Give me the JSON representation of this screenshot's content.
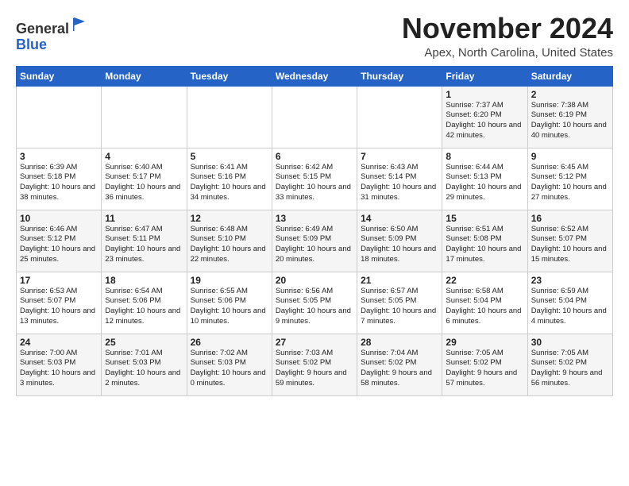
{
  "logo": {
    "general": "General",
    "blue": "Blue"
  },
  "header": {
    "month": "November 2024",
    "location": "Apex, North Carolina, United States"
  },
  "weekdays": [
    "Sunday",
    "Monday",
    "Tuesday",
    "Wednesday",
    "Thursday",
    "Friday",
    "Saturday"
  ],
  "weeks": [
    [
      {
        "day": "",
        "info": ""
      },
      {
        "day": "",
        "info": ""
      },
      {
        "day": "",
        "info": ""
      },
      {
        "day": "",
        "info": ""
      },
      {
        "day": "",
        "info": ""
      },
      {
        "day": "1",
        "info": "Sunrise: 7:37 AM\nSunset: 6:20 PM\nDaylight: 10 hours\nand 42 minutes."
      },
      {
        "day": "2",
        "info": "Sunrise: 7:38 AM\nSunset: 6:19 PM\nDaylight: 10 hours\nand 40 minutes."
      }
    ],
    [
      {
        "day": "3",
        "info": "Sunrise: 6:39 AM\nSunset: 5:18 PM\nDaylight: 10 hours\nand 38 minutes."
      },
      {
        "day": "4",
        "info": "Sunrise: 6:40 AM\nSunset: 5:17 PM\nDaylight: 10 hours\nand 36 minutes."
      },
      {
        "day": "5",
        "info": "Sunrise: 6:41 AM\nSunset: 5:16 PM\nDaylight: 10 hours\nand 34 minutes."
      },
      {
        "day": "6",
        "info": "Sunrise: 6:42 AM\nSunset: 5:15 PM\nDaylight: 10 hours\nand 33 minutes."
      },
      {
        "day": "7",
        "info": "Sunrise: 6:43 AM\nSunset: 5:14 PM\nDaylight: 10 hours\nand 31 minutes."
      },
      {
        "day": "8",
        "info": "Sunrise: 6:44 AM\nSunset: 5:13 PM\nDaylight: 10 hours\nand 29 minutes."
      },
      {
        "day": "9",
        "info": "Sunrise: 6:45 AM\nSunset: 5:12 PM\nDaylight: 10 hours\nand 27 minutes."
      }
    ],
    [
      {
        "day": "10",
        "info": "Sunrise: 6:46 AM\nSunset: 5:12 PM\nDaylight: 10 hours\nand 25 minutes."
      },
      {
        "day": "11",
        "info": "Sunrise: 6:47 AM\nSunset: 5:11 PM\nDaylight: 10 hours\nand 23 minutes."
      },
      {
        "day": "12",
        "info": "Sunrise: 6:48 AM\nSunset: 5:10 PM\nDaylight: 10 hours\nand 22 minutes."
      },
      {
        "day": "13",
        "info": "Sunrise: 6:49 AM\nSunset: 5:09 PM\nDaylight: 10 hours\nand 20 minutes."
      },
      {
        "day": "14",
        "info": "Sunrise: 6:50 AM\nSunset: 5:09 PM\nDaylight: 10 hours\nand 18 minutes."
      },
      {
        "day": "15",
        "info": "Sunrise: 6:51 AM\nSunset: 5:08 PM\nDaylight: 10 hours\nand 17 minutes."
      },
      {
        "day": "16",
        "info": "Sunrise: 6:52 AM\nSunset: 5:07 PM\nDaylight: 10 hours\nand 15 minutes."
      }
    ],
    [
      {
        "day": "17",
        "info": "Sunrise: 6:53 AM\nSunset: 5:07 PM\nDaylight: 10 hours\nand 13 minutes."
      },
      {
        "day": "18",
        "info": "Sunrise: 6:54 AM\nSunset: 5:06 PM\nDaylight: 10 hours\nand 12 minutes."
      },
      {
        "day": "19",
        "info": "Sunrise: 6:55 AM\nSunset: 5:06 PM\nDaylight: 10 hours\nand 10 minutes."
      },
      {
        "day": "20",
        "info": "Sunrise: 6:56 AM\nSunset: 5:05 PM\nDaylight: 10 hours\nand 9 minutes."
      },
      {
        "day": "21",
        "info": "Sunrise: 6:57 AM\nSunset: 5:05 PM\nDaylight: 10 hours\nand 7 minutes."
      },
      {
        "day": "22",
        "info": "Sunrise: 6:58 AM\nSunset: 5:04 PM\nDaylight: 10 hours\nand 6 minutes."
      },
      {
        "day": "23",
        "info": "Sunrise: 6:59 AM\nSunset: 5:04 PM\nDaylight: 10 hours\nand 4 minutes."
      }
    ],
    [
      {
        "day": "24",
        "info": "Sunrise: 7:00 AM\nSunset: 5:03 PM\nDaylight: 10 hours\nand 3 minutes."
      },
      {
        "day": "25",
        "info": "Sunrise: 7:01 AM\nSunset: 5:03 PM\nDaylight: 10 hours\nand 2 minutes."
      },
      {
        "day": "26",
        "info": "Sunrise: 7:02 AM\nSunset: 5:03 PM\nDaylight: 10 hours\nand 0 minutes."
      },
      {
        "day": "27",
        "info": "Sunrise: 7:03 AM\nSunset: 5:02 PM\nDaylight: 9 hours\nand 59 minutes."
      },
      {
        "day": "28",
        "info": "Sunrise: 7:04 AM\nSunset: 5:02 PM\nDaylight: 9 hours\nand 58 minutes."
      },
      {
        "day": "29",
        "info": "Sunrise: 7:05 AM\nSunset: 5:02 PM\nDaylight: 9 hours\nand 57 minutes."
      },
      {
        "day": "30",
        "info": "Sunrise: 7:05 AM\nSunset: 5:02 PM\nDaylight: 9 hours\nand 56 minutes."
      }
    ]
  ]
}
